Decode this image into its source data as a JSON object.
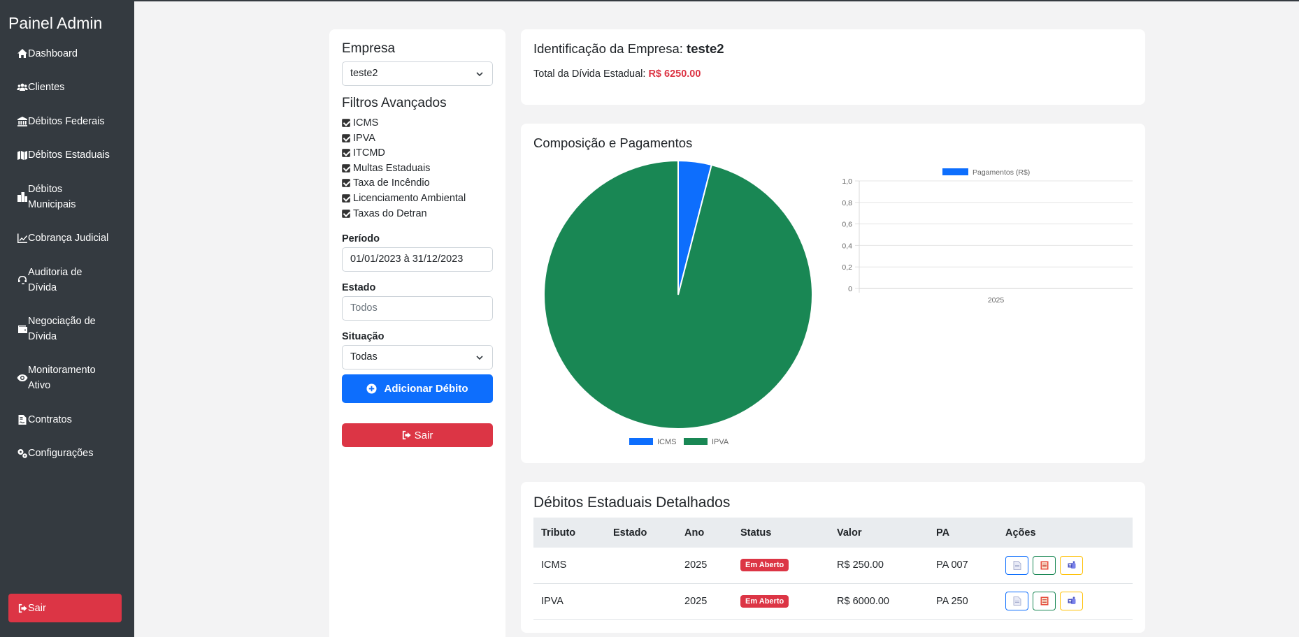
{
  "sidebar": {
    "brand": "Painel Admin",
    "items": [
      {
        "label": "Dashboard",
        "icon": "home-icon"
      },
      {
        "label": "Clientes",
        "icon": "users-icon"
      },
      {
        "label": "Débitos Federais",
        "icon": "bank-icon"
      },
      {
        "label": "Débitos Estaduais",
        "icon": "map-icon"
      },
      {
        "label1": "Débitos",
        "label2": "Municipais",
        "icon": "city-icon"
      },
      {
        "label": "Cobrança Judicial",
        "icon": "chart-line-icon"
      },
      {
        "label1": "Auditoria de",
        "label2": "Dívida",
        "icon": "headset-icon"
      },
      {
        "label1": "Negociação de",
        "label2": "Dívida",
        "icon": "wallet-icon"
      },
      {
        "label1": "Monitoramento",
        "label2": "Ativo",
        "icon": "eye-icon"
      },
      {
        "label": "Contratos",
        "icon": "file-contract-icon"
      },
      {
        "label": "Configurações",
        "icon": "gears-icon"
      }
    ],
    "logout": "Sair"
  },
  "filters": {
    "empresa_label": "Empresa",
    "empresa_value": "teste2",
    "advanced_label": "Filtros Avançados",
    "checkboxes": [
      "ICMS",
      "IPVA",
      "ITCMD",
      "Multas Estaduais",
      "Taxa de Incêndio",
      "Licenciamento Ambiental",
      "Taxas do Detran"
    ],
    "periodo_label": "Período",
    "periodo_value": "01/01/2023 à 31/12/2023",
    "estado_label": "Estado",
    "estado_placeholder": "Todos",
    "situacao_label": "Situação",
    "situacao_value": "Todas",
    "add_button": "Adicionar Débito",
    "logout_button": "Sair"
  },
  "company": {
    "ident_prefix": "Identificação da Empresa:",
    "name": "teste2",
    "total_label": "Total da Dívida Estadual:",
    "total_value": "R$ 6250.00"
  },
  "charts_card": {
    "title": "Composição e Pagamentos"
  },
  "chart_data": [
    {
      "type": "pie",
      "categories": [
        "ICMS",
        "IPVA"
      ],
      "values": [
        250,
        6000
      ],
      "colors": [
        "#0d6efd",
        "#198754"
      ],
      "legend": "bottom"
    },
    {
      "type": "bar",
      "categories": [
        "2025"
      ],
      "series": [
        {
          "name": "Pagamentos (R$)",
          "values": [
            0
          ],
          "color": "#0d6efd"
        }
      ],
      "yticks": [
        "1,0",
        "0,8",
        "0,6",
        "0,4",
        "0,2",
        "0"
      ],
      "ylim": [
        0,
        1
      ],
      "legend": "top",
      "grid": true
    }
  ],
  "table": {
    "title": "Débitos Estaduais Detalhados",
    "headers": [
      "Tributo",
      "Estado",
      "Ano",
      "Status",
      "Valor",
      "PA",
      "Ações"
    ],
    "rows": [
      {
        "tributo": "ICMS",
        "estado": "",
        "ano": "2025",
        "status": "Em Aberto",
        "valor": "R$ 250.00",
        "pa": "PA 007"
      },
      {
        "tributo": "IPVA",
        "estado": "",
        "ano": "2025",
        "status": "Em Aberto",
        "valor": "R$ 6000.00",
        "pa": "PA 250"
      }
    ]
  }
}
